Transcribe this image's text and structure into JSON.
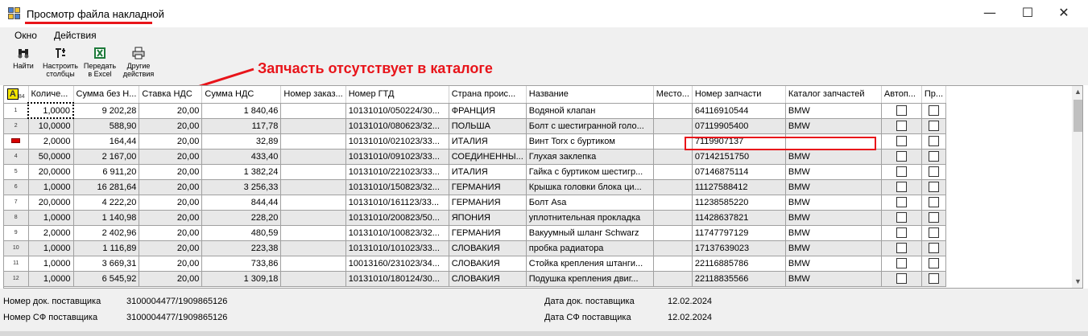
{
  "window": {
    "title": "Просмотр файла накладной",
    "minimize": "—",
    "maximize": "☐",
    "close": "✕"
  },
  "menu": [
    "Окно",
    "Действия"
  ],
  "toolbar": [
    {
      "line1": "Найти",
      "line2": "",
      "icon": "binoculars-icon"
    },
    {
      "line1": "Настроить",
      "line2": "столбцы",
      "icon": "columns-icon"
    },
    {
      "line1": "Передать",
      "line2": "в Excel",
      "icon": "excel-icon"
    },
    {
      "line1": "Другие",
      "line2": "действия",
      "icon": "printer-icon"
    }
  ],
  "annotation": "Запчасть отсутствует в каталоге",
  "grid": {
    "corner_label": "A",
    "corner_sub": "84",
    "columns": [
      "Количе...",
      "Сумма без Н...",
      "Ставка НДС",
      "Сумма НДС",
      "Номер заказ...",
      "Номер ГТД",
      "Страна проис...",
      "Название",
      "Место...",
      "Номер запчасти",
      "Каталог запчастей",
      "Автоп...",
      "Пр..."
    ],
    "rows": [
      {
        "n": "1",
        "qty": "1,0000",
        "sum": "9 202,28",
        "vat": "20,00",
        "vatsum": "1 840,46",
        "order": "",
        "gtd": "10131010/050224/30...",
        "country": "ФРАНЦИЯ",
        "name": "Водяной клапан",
        "place": "",
        "part": "64116910544",
        "catalog": "BMW"
      },
      {
        "n": "2",
        "qty": "10,0000",
        "sum": "588,90",
        "vat": "20,00",
        "vatsum": "117,78",
        "order": "",
        "gtd": "10131010/080623/32...",
        "country": "ПОЛЬША",
        "name": "Болт с шестигранной голо...",
        "place": "",
        "part": "07119905400",
        "catalog": "BMW"
      },
      {
        "n": "",
        "qty": "2,0000",
        "sum": "164,44",
        "vat": "20,00",
        "vatsum": "32,89",
        "order": "",
        "gtd": "10131010/021023/33...",
        "country": "ИТАЛИЯ",
        "name": "Винт Torx с буртиком",
        "place": "",
        "part": "7119907137",
        "catalog": ""
      },
      {
        "n": "4",
        "qty": "50,0000",
        "sum": "2 167,00",
        "vat": "20,00",
        "vatsum": "433,40",
        "order": "",
        "gtd": "10131010/091023/33...",
        "country": "СОЕДИНЕННЫ...",
        "name": "Глухая заклепка",
        "place": "",
        "part": "07142151750",
        "catalog": "BMW"
      },
      {
        "n": "5",
        "qty": "20,0000",
        "sum": "6 911,20",
        "vat": "20,00",
        "vatsum": "1 382,24",
        "order": "",
        "gtd": "10131010/221023/33...",
        "country": "ИТАЛИЯ",
        "name": "Гайка с буртиком шестигр...",
        "place": "",
        "part": "07146875114",
        "catalog": "BMW"
      },
      {
        "n": "6",
        "qty": "1,0000",
        "sum": "16 281,64",
        "vat": "20,00",
        "vatsum": "3 256,33",
        "order": "",
        "gtd": "10131010/150823/32...",
        "country": "ГЕРМАНИЯ",
        "name": "Крышка головки блока ци...",
        "place": "",
        "part": "11127588412",
        "catalog": "BMW"
      },
      {
        "n": "7",
        "qty": "20,0000",
        "sum": "4 222,20",
        "vat": "20,00",
        "vatsum": "844,44",
        "order": "",
        "gtd": "10131010/161123/33...",
        "country": "ГЕРМАНИЯ",
        "name": "Болт Asa",
        "place": "",
        "part": "11238585220",
        "catalog": "BMW"
      },
      {
        "n": "8",
        "qty": "1,0000",
        "sum": "1 140,98",
        "vat": "20,00",
        "vatsum": "228,20",
        "order": "",
        "gtd": "10131010/200823/50...",
        "country": "ЯПОНИЯ",
        "name": "уплотнительная прокладка",
        "place": "",
        "part": "11428637821",
        "catalog": "BMW"
      },
      {
        "n": "9",
        "qty": "2,0000",
        "sum": "2 402,96",
        "vat": "20,00",
        "vatsum": "480,59",
        "order": "",
        "gtd": "10131010/100823/32...",
        "country": "ГЕРМАНИЯ",
        "name": "Вакуумный шланг Schwarz",
        "place": "",
        "part": "11747797129",
        "catalog": "BMW"
      },
      {
        "n": "10",
        "qty": "1,0000",
        "sum": "1 116,89",
        "vat": "20,00",
        "vatsum": "223,38",
        "order": "",
        "gtd": "10131010/101023/33...",
        "country": "СЛОВАКИЯ",
        "name": "пробка радиатора",
        "place": "",
        "part": "17137639023",
        "catalog": "BMW"
      },
      {
        "n": "11",
        "qty": "1,0000",
        "sum": "3 669,31",
        "vat": "20,00",
        "vatsum": "733,86",
        "order": "",
        "gtd": "10013160/231023/34...",
        "country": "СЛОВАКИЯ",
        "name": "Стойка крепления штанги...",
        "place": "",
        "part": "22116885786",
        "catalog": "BMW"
      },
      {
        "n": "12",
        "qty": "1,0000",
        "sum": "6 545,92",
        "vat": "20,00",
        "vatsum": "1 309,18",
        "order": "",
        "gtd": "10131010/180124/30...",
        "country": "СЛОВАКИЯ",
        "name": "Подушка крепления двиг...",
        "place": "",
        "part": "22118835566",
        "catalog": "BMW"
      }
    ]
  },
  "footer": {
    "supplier_doc_label": "Номер док. поставщика",
    "supplier_doc_value": "3100004477/1909865126",
    "supplier_sf_label": "Номер СФ поставщика",
    "supplier_sf_value": "3100004477/1909865126",
    "doc_date_label": "Дата док. поставщика",
    "doc_date_value": "12.02.2024",
    "sf_date_label": "Дата СФ поставщика",
    "sf_date_value": "12.02.2024"
  }
}
